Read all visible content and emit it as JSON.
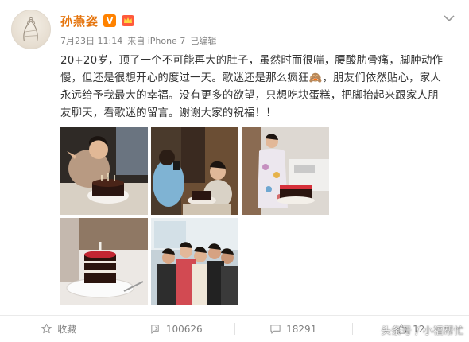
{
  "post": {
    "author": "孙燕姿",
    "verified_badge": "V",
    "timestamp": "7月23日 11:14",
    "source": "来自 iPhone 7",
    "edited": "已编辑",
    "text_line1": "20+20岁，顶了一个不可能再大的肚子，虽然时而很喘，腰酸肋骨痛，脚肿动作",
    "text_line2": "慢，但还是很想开心的度过一天。歌迷还是那么疯狂🙈，朋友们依然贴心，家人",
    "text_line3": "永远给予我最大的幸福。没有更多的欲望，只想吃块蛋糕，把脚抬起来跟家人朋",
    "text_line4": "友聊天，看歌迷的留言。谢谢大家的祝福！！"
  },
  "photos": [
    {
      "name": "photo-birthday-cake-sitting"
    },
    {
      "name": "photo-friends-taking-picture"
    },
    {
      "name": "photo-standing-with-cake"
    },
    {
      "name": "photo-cake-closeup"
    },
    {
      "name": "photo-group-family"
    }
  ],
  "actions": {
    "favorite_label": "收藏",
    "repost_count": "100626",
    "comment_count": "18291",
    "like_count": "12"
  },
  "watermark": "头条号 / 小福帮忙",
  "icons": {
    "favorite": "star-icon",
    "repost": "repost-icon",
    "comment": "comment-icon",
    "like": "thumbs-up-icon",
    "menu": "chevron-down-icon"
  },
  "colors": {
    "author_name": "#e5750e",
    "verified_badge": "#ff8200",
    "meta_text": "#808080"
  }
}
